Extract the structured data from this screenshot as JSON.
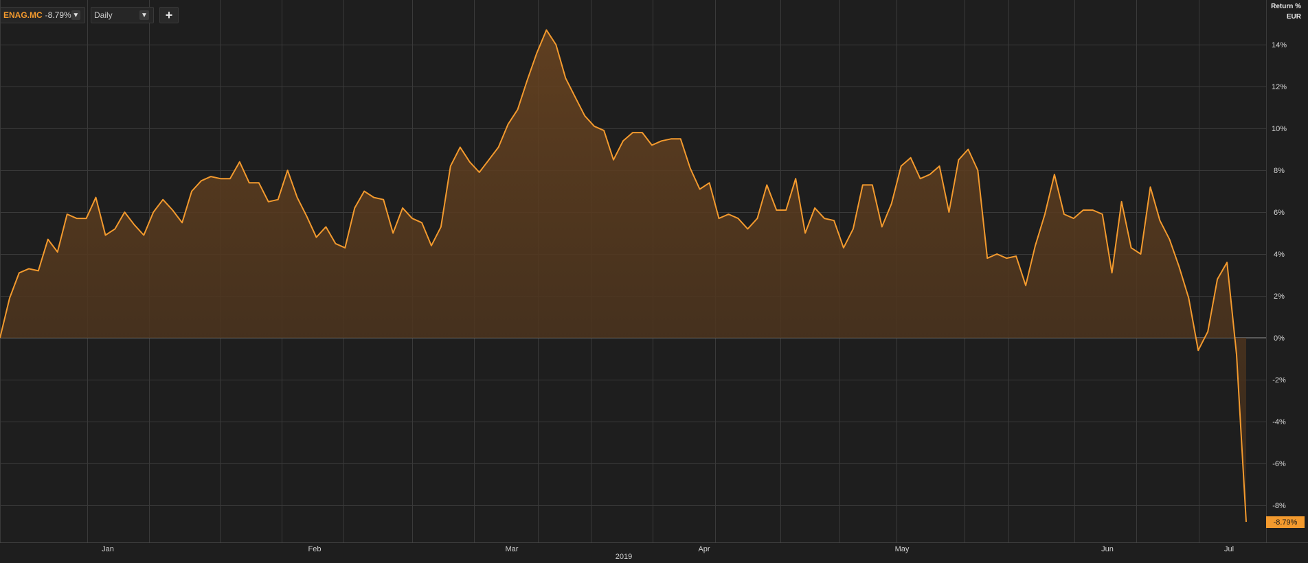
{
  "toolbar": {
    "symbol": "ENAG.MC",
    "symbol_value": "-8.79%",
    "interval": "Daily",
    "add_label": "+"
  },
  "axis_units": {
    "measure": "Return %",
    "currency": "EUR"
  },
  "last_value_label": "-8.79%",
  "colors": {
    "line": "#f39a2e",
    "fill_top": "#6a4420",
    "fill_bottom": "#3a2a1c",
    "grid": "#3a3a3a",
    "background": "#1e1e1e"
  },
  "chart_data": {
    "type": "area",
    "year_label": "2019",
    "x_labels": [
      "Jan",
      "Feb",
      "Mar",
      "Apr",
      "May",
      "Jun",
      "Jul"
    ],
    "y_ticks": [
      "14%",
      "12%",
      "10%",
      "8%",
      "6%",
      "4%",
      "2%",
      "0%",
      "-2%",
      "-4%",
      "-6%",
      "-8%"
    ],
    "ylim": [
      -9.5,
      15.5
    ],
    "grid": true,
    "series": [
      {
        "values": [
          0.0,
          1.9,
          3.1,
          3.3,
          3.2,
          4.7,
          4.1,
          5.9,
          5.7,
          5.7,
          6.7,
          4.9,
          5.2,
          6.0,
          5.4,
          4.9,
          6.0,
          6.6,
          6.1,
          5.5,
          7.0,
          7.5,
          7.7,
          7.6,
          7.6,
          8.4,
          7.4,
          7.4,
          6.5,
          6.6,
          8.0,
          6.7,
          5.8,
          4.8,
          5.3,
          4.5,
          4.3,
          6.2,
          7.0,
          6.7,
          6.6,
          5.0,
          6.2,
          5.7,
          5.5,
          4.4,
          5.3,
          8.2,
          9.1,
          8.4,
          7.9,
          8.5,
          9.1,
          10.2,
          10.9,
          12.3,
          13.6,
          14.7,
          14.0,
          12.4,
          11.5,
          10.6,
          10.1,
          9.9,
          8.5,
          9.4,
          9.8,
          9.8,
          9.2,
          9.4,
          9.5,
          9.5,
          8.1,
          7.1,
          7.4,
          5.7,
          5.9,
          5.7,
          5.2,
          5.7,
          7.3,
          6.1,
          6.1,
          7.6,
          5.0,
          6.2,
          5.7,
          5.6,
          4.3,
          5.2,
          7.3,
          7.3,
          5.3,
          6.4,
          8.2,
          8.6,
          7.6,
          7.8,
          8.2,
          6.0,
          8.5,
          9.0,
          8.0,
          3.8,
          4.0,
          3.8,
          3.9,
          2.5,
          4.4,
          5.9,
          7.8,
          5.9,
          5.7,
          6.1,
          6.1,
          5.9,
          3.1,
          6.5,
          4.3,
          4.0,
          7.2,
          5.6,
          4.7,
          3.4,
          1.9,
          -0.6,
          0.3,
          2.8,
          3.6,
          -0.8,
          -8.79
        ]
      }
    ]
  }
}
